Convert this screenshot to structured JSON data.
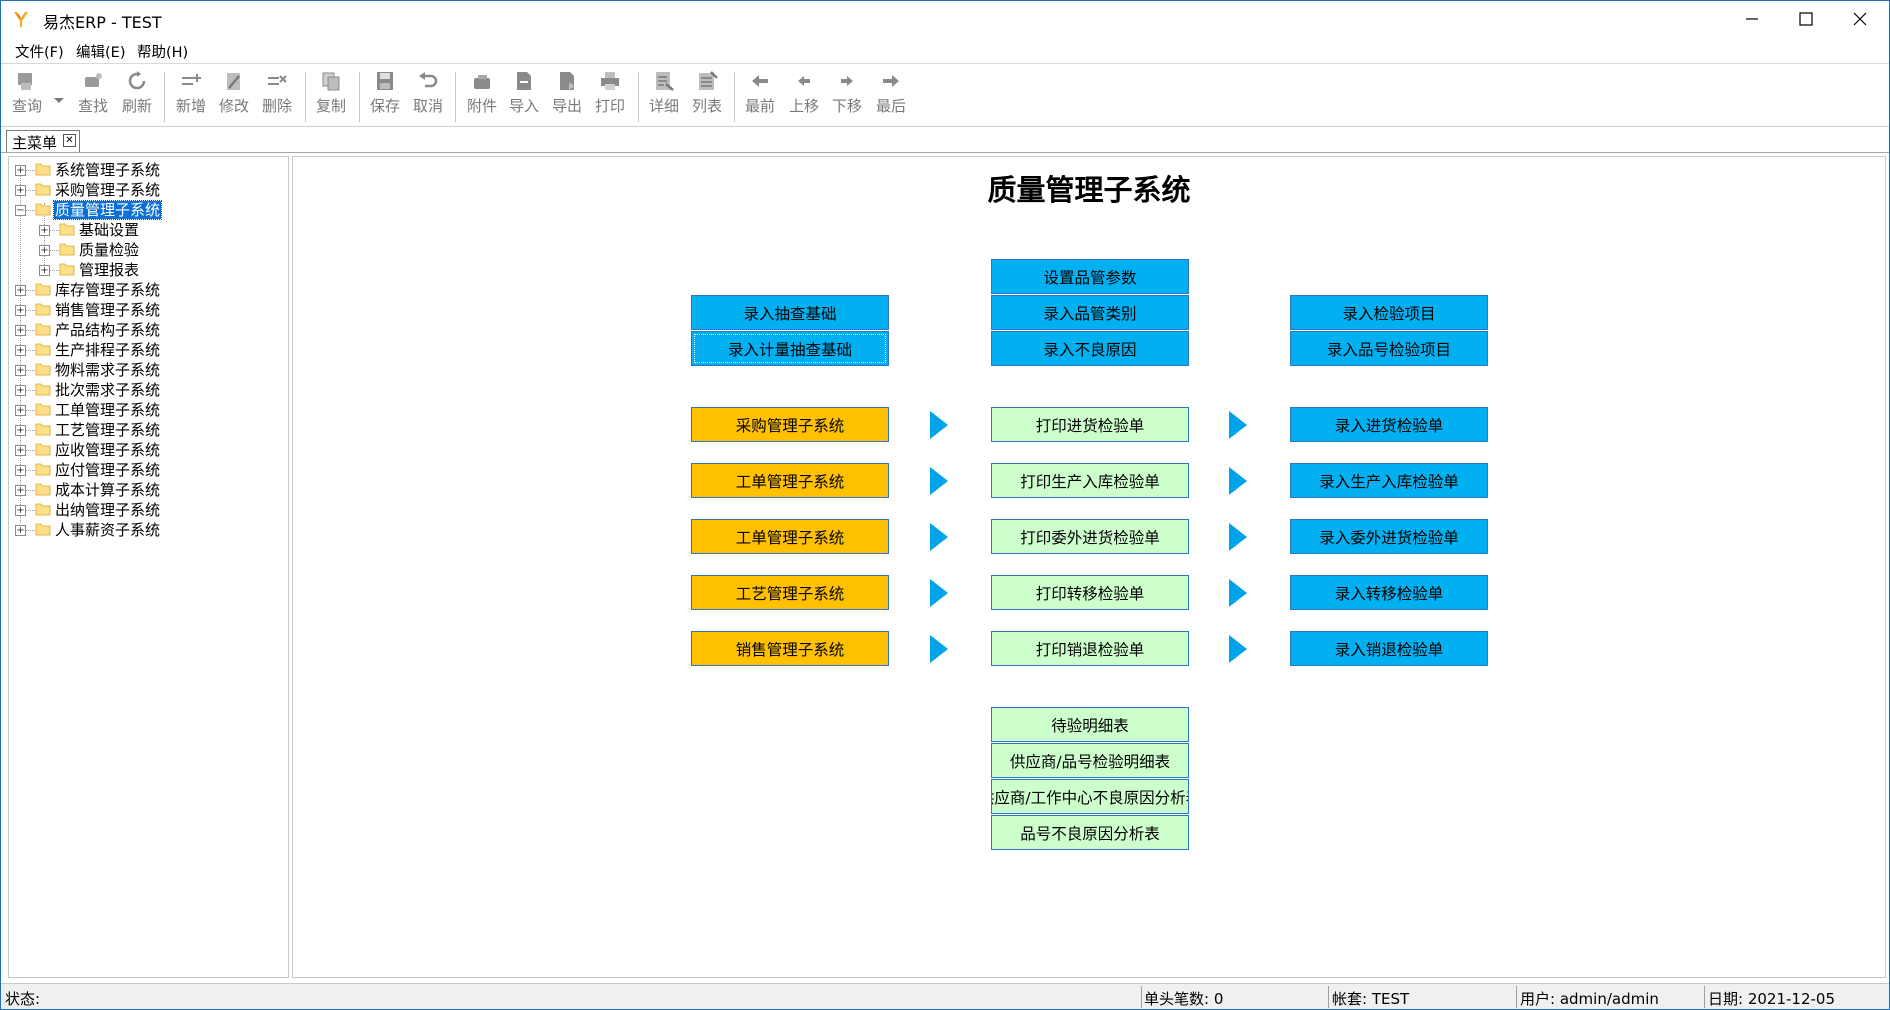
{
  "window": {
    "title": "易杰ERP - TEST"
  },
  "menu": [
    {
      "label": "文件(F)"
    },
    {
      "label": "编辑(E)"
    },
    {
      "label": "帮助(H)"
    }
  ],
  "toolbar": {
    "query": "查询",
    "find": "查找",
    "refresh": "刷新",
    "add": "新增",
    "edit": "修改",
    "delete": "删除",
    "copy": "复制",
    "save": "保存",
    "cancel": "取消",
    "attach": "附件",
    "import": "导入",
    "export": "导出",
    "print": "打印",
    "detail": "详细",
    "list": "列表",
    "first": "最前",
    "prev": "上移",
    "next": "下移",
    "last": "最后"
  },
  "tab": {
    "label": "主菜单",
    "close": "✕"
  },
  "tree": {
    "items": [
      {
        "label": "系统管理子系统",
        "expander": "+"
      },
      {
        "label": "采购管理子系统",
        "expander": "+"
      },
      {
        "label": "质量管理子系统",
        "expander": "−"
      },
      {
        "label": "基础设置",
        "expander": "+"
      },
      {
        "label": "质量检验",
        "expander": "+"
      },
      {
        "label": "管理报表",
        "expander": "+"
      },
      {
        "label": "库存管理子系统",
        "expander": "+"
      },
      {
        "label": "销售管理子系统",
        "expander": "+"
      },
      {
        "label": "产品结构子系统",
        "expander": "+"
      },
      {
        "label": "生产排程子系统",
        "expander": "+"
      },
      {
        "label": "物料需求子系统",
        "expander": "+"
      },
      {
        "label": "批次需求子系统",
        "expander": "+"
      },
      {
        "label": "工单管理子系统",
        "expander": "+"
      },
      {
        "label": "工艺管理子系统",
        "expander": "+"
      },
      {
        "label": "应收管理子系统",
        "expander": "+"
      },
      {
        "label": "应付管理子系统",
        "expander": "+"
      },
      {
        "label": "成本计算子系统",
        "expander": "+"
      },
      {
        "label": "出纳管理子系统",
        "expander": "+"
      },
      {
        "label": "人事薪资子系统",
        "expander": "+"
      }
    ]
  },
  "main": {
    "title": "质量管理子系统",
    "setup_left": [
      "录入抽查基础",
      "录入计量抽查基础"
    ],
    "setup_center": [
      "设置品管参数",
      "录入品管类别",
      "录入不良原因"
    ],
    "setup_right": [
      "录入检验项目",
      "录入品号检验项目"
    ],
    "sources": [
      "采购管理子系统",
      "工单管理子系统",
      "工单管理子系统",
      "工艺管理子系统",
      "销售管理子系统"
    ],
    "prints": [
      "打印进货检验单",
      "打印生产入库检验单",
      "打印委外进货检验单",
      "打印转移检验单",
      "打印销退检验单"
    ],
    "entries": [
      "录入进货检验单",
      "录入生产入库检验单",
      "录入委外进货检验单",
      "录入转移检验单",
      "录入销退检验单"
    ],
    "reports": [
      "待验明细表",
      "供应商/品号检验明细表",
      "供应商/工作中心不良原因分析表",
      "品号不良原因分析表"
    ],
    "colors": {
      "blue": "#00b0f0",
      "green": "#ccffcc",
      "orange": "#ffc000",
      "arrow": "#00a2e8"
    }
  },
  "status": {
    "state": "状态:",
    "records": "单头笔数: 0",
    "account": "帐套: TEST",
    "user": "用户: admin/admin",
    "date": "日期: 2021-12-05"
  }
}
